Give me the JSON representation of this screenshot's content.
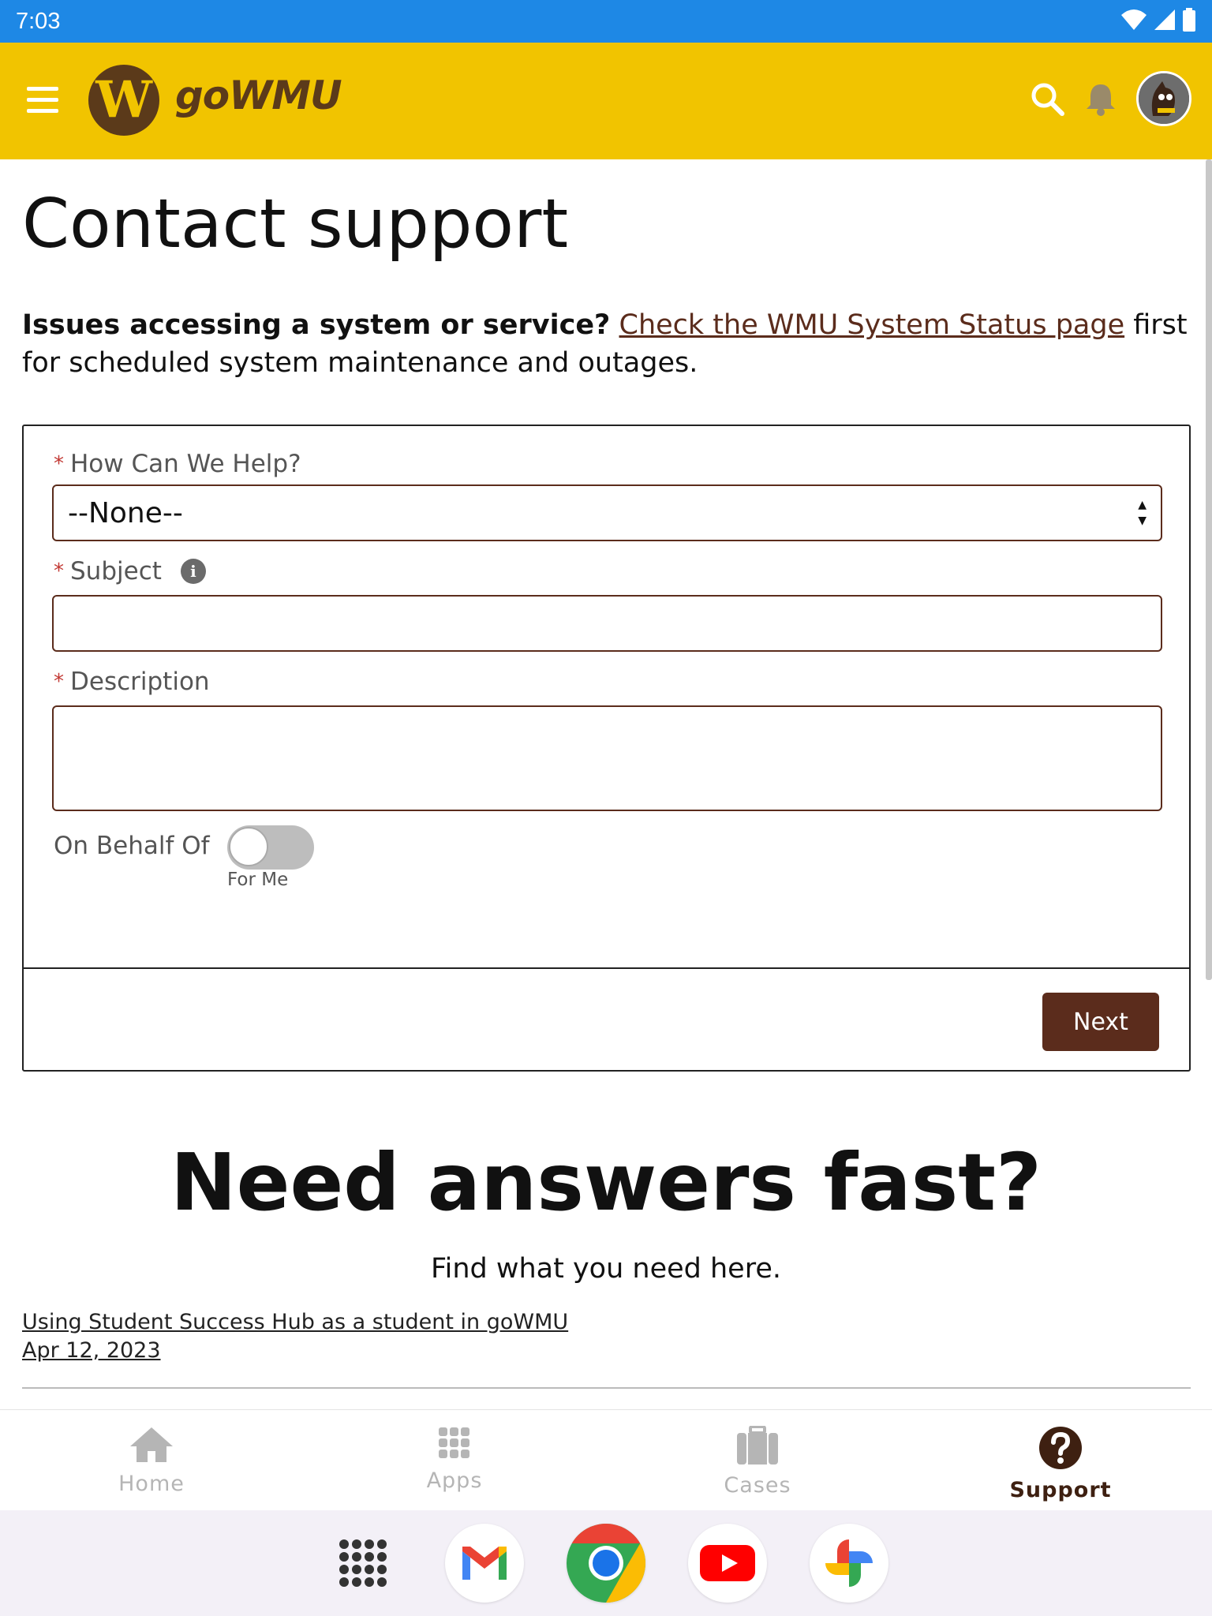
{
  "status_bar": {
    "time": "7:03",
    "icons": [
      "wifi-icon",
      "signal-icon",
      "battery-icon"
    ]
  },
  "app_header": {
    "logo_letter": "W",
    "brand_name": "goWMU",
    "icons": [
      "hamburger-menu-icon",
      "search-icon",
      "bell-icon",
      "avatar"
    ],
    "colors": {
      "header_bg": "#F1C400",
      "brand_brown": "#5B3A1A"
    }
  },
  "main": {
    "title": "Contact support",
    "intro_bold": "Issues accessing a system or service?",
    "intro_link": "Check the WMU System Status page",
    "intro_rest_1": " first",
    "intro_rest_2": "for scheduled system maintenance and outages."
  },
  "form": {
    "help_label": "How Can We Help?",
    "help_selected": "--None--",
    "subject_label": "Subject",
    "subject_value": "",
    "description_label": "Description",
    "description_value": "",
    "required_marker": "*",
    "info_glyph": "i",
    "behalf_label": "On Behalf Of",
    "behalf_toggle_caption": "For Me",
    "behalf_toggle_on": false,
    "next_label": "Next",
    "colors": {
      "accent": "#5B2C1C",
      "required": "#C23934"
    }
  },
  "answers": {
    "title": "Need answers fast?",
    "subtitle": "Find what you need here.",
    "articles": [
      {
        "title": "Using Student Success Hub as a student in goWMU",
        "date": "Apr 12, 2023"
      }
    ]
  },
  "tab_bar": {
    "tabs": [
      {
        "label": "Home",
        "icon": "home-icon",
        "active": false
      },
      {
        "label": "Apps",
        "icon": "apps-grid-icon",
        "active": false
      },
      {
        "label": "Cases",
        "icon": "briefcase-icon",
        "active": false
      },
      {
        "label": "Support",
        "icon": "help-circle-icon",
        "active": true
      }
    ]
  },
  "dock": {
    "apps": [
      "app-drawer-icon",
      "gmail-icon",
      "chrome-icon",
      "youtube-icon",
      "photos-icon"
    ]
  }
}
